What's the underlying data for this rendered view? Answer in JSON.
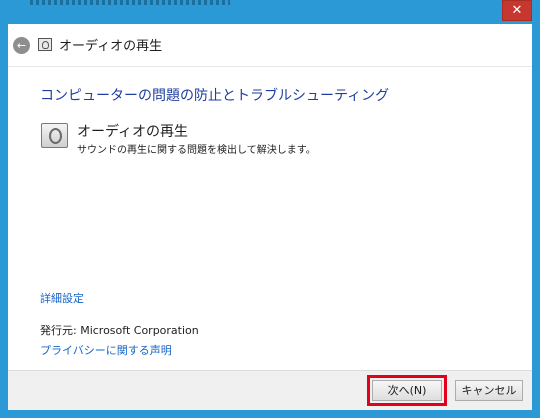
{
  "window": {
    "close_glyph": "✕",
    "accent_color": "#2b99d6",
    "close_color": "#c7372f"
  },
  "nav": {
    "back_glyph": "←",
    "icon": "audio-troubleshooter-icon",
    "title": "オーディオの再生"
  },
  "content": {
    "heading": "コンピューターの問題の防止とトラブルシューティング",
    "item": {
      "icon": "speaker-icon",
      "title": "オーディオの再生",
      "description": "サウンドの再生に関する問題を検出して解決します。"
    },
    "advanced_link": "詳細設定",
    "publisher": "発行元:  Microsoft Corporation",
    "privacy_link": "プライバシーに関する声明"
  },
  "footer": {
    "next_label": "次へ(N)",
    "cancel_label": "キャンセル",
    "highlight_color": "#e3001b"
  }
}
